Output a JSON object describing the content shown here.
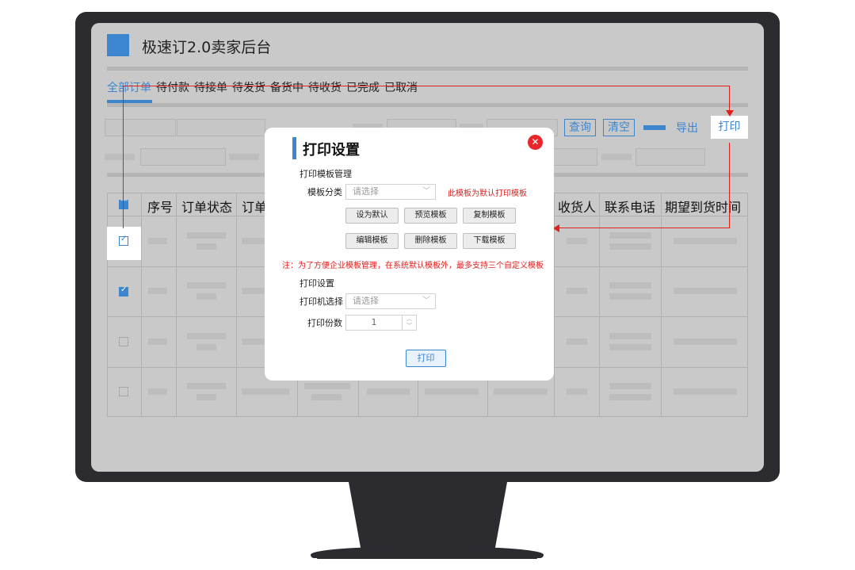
{
  "app": {
    "title": "极速订2.0卖家后台"
  },
  "tabs": [
    {
      "label": "全部订单",
      "active": true
    },
    {
      "label": "待付款"
    },
    {
      "label": "待接单"
    },
    {
      "label": "待发货"
    },
    {
      "label": "备货中"
    },
    {
      "label": "待收货"
    },
    {
      "label": "已完成"
    },
    {
      "label": "已取消"
    }
  ],
  "toolbar": {
    "query": "查询",
    "clear": "清空",
    "export": "导出",
    "print": "打印"
  },
  "table": {
    "headers": [
      "序号",
      "订单状态",
      "订单",
      "收货人",
      "联系电话",
      "期望到货时间"
    ],
    "rows": [
      {
        "checked": true
      },
      {
        "checked": true
      },
      {
        "checked": false
      },
      {
        "checked": false
      }
    ]
  },
  "modal": {
    "title": "打印设置",
    "section_template": "打印模板管理",
    "template_category_label": "模板分类",
    "template_category_placeholder": "请选择",
    "default_hint": "此模板为默认打印模板",
    "buttons": [
      "设为默认",
      "预览模板",
      "复制模板",
      "编辑模板",
      "删除模板",
      "下载模板"
    ],
    "note": "注：为了方便企业模板管理，在系统默认模板外，最多支持三个自定义模板",
    "section_print": "打印设置",
    "printer_label": "打印机选择",
    "printer_placeholder": "请选择",
    "copies_label": "打印份数",
    "copies_value": "1",
    "print_button": "打印"
  },
  "colors": {
    "accent": "#3d86cf",
    "alert": "#e0201f",
    "close": "#e8262c",
    "bezel": "#2b2b30"
  }
}
